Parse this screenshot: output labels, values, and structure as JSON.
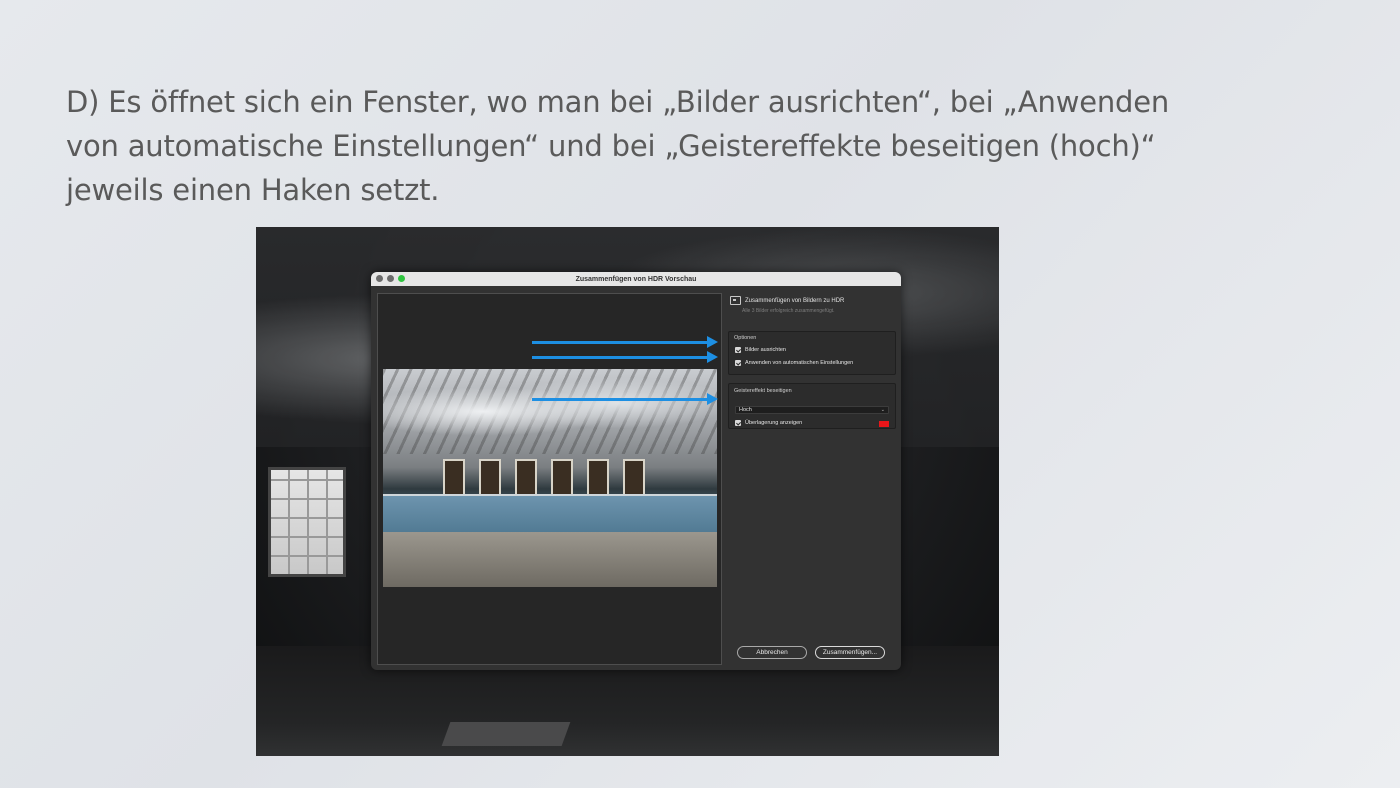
{
  "slide": {
    "text_line1": "D) Es öffnet sich ein Fenster, wo man bei „Bilder ausrichten“,   bei „Anwenden",
    "text_line2": "von automatische Einstellungen“ und bei „Geistereffekte beseitigen (hoch)“",
    "text_line3": "jeweils einen Haken setzt."
  },
  "dialog": {
    "title": "Zusammenfügen von HDR Vorschau",
    "traffic_colors": [
      "#6b6b6b",
      "#6b6b6b",
      "#2ec43f"
    ],
    "panel": {
      "heading": "Zusammenfügen von Bildern zu HDR",
      "subheading": "Alle 3 Bilder erfolgreich zusammengefügt.",
      "options": {
        "label": "Optionen",
        "align_images": {
          "label": "Bilder ausrichten",
          "checked": true
        },
        "auto_settings": {
          "label": "Anwenden von automatischen Einstellungen",
          "checked": true
        }
      },
      "ghost": {
        "label": "Geistereffekt beseitigen",
        "level": "Hoch",
        "overlay": {
          "label": "Überlagerung anzeigen",
          "checked": true
        },
        "overlay_color": "#e8161a"
      }
    },
    "buttons": {
      "cancel": "Abbrechen",
      "merge": "Zusammenfügen..."
    }
  },
  "annotations": {
    "arrow_color": "#1d8fe3"
  }
}
